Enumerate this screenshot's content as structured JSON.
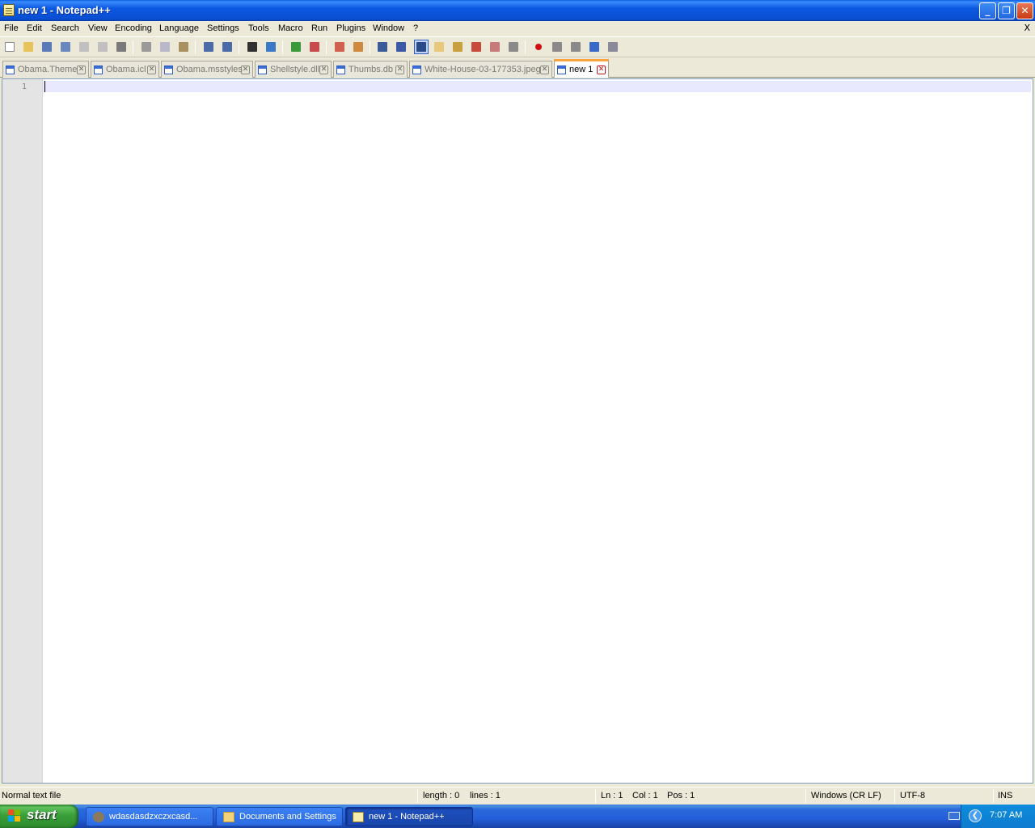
{
  "window": {
    "title": "new 1 - Notepad++",
    "min_glyph": "_",
    "max_glyph": "❐",
    "close_glyph": "✕"
  },
  "menu": {
    "items": [
      "File",
      "Edit",
      "Search",
      "View",
      "Encoding",
      "Language",
      "Settings",
      "Tools",
      "Macro",
      "Run",
      "Plugins",
      "Window",
      "?"
    ],
    "close": "X"
  },
  "toolbar": {
    "buttons": [
      {
        "name": "new-file-icon",
        "color": "#ffffff"
      },
      {
        "name": "open-file-icon",
        "color": "#e8c25a"
      },
      {
        "name": "save-icon",
        "color": "#5a7ab8"
      },
      {
        "name": "save-all-icon",
        "color": "#6a88c0"
      },
      {
        "name": "close-icon",
        "color": "#c0c0c0"
      },
      {
        "name": "close-all-icon",
        "color": "#c0c0c0"
      },
      {
        "name": "print-icon",
        "color": "#7a7a7a"
      },
      {
        "name": "cut-icon",
        "color": "#9a9a9a"
      },
      {
        "name": "copy-icon",
        "color": "#b8b8c8"
      },
      {
        "name": "paste-icon",
        "color": "#a89060"
      },
      {
        "name": "undo-icon",
        "color": "#4a6aa8"
      },
      {
        "name": "redo-icon",
        "color": "#4a6aa8"
      },
      {
        "name": "find-icon",
        "color": "#303030"
      },
      {
        "name": "replace-icon",
        "color": "#3a78c8"
      },
      {
        "name": "zoom-in-icon",
        "color": "#3a9a3a"
      },
      {
        "name": "zoom-out-icon",
        "color": "#c84a4a"
      },
      {
        "name": "sync-vertical-icon",
        "color": "#d06050"
      },
      {
        "name": "sync-horizontal-icon",
        "color": "#d08a40"
      },
      {
        "name": "word-wrap-icon",
        "color": "#3a5a9a"
      },
      {
        "name": "show-all-chars-icon",
        "color": "#3a5aa8"
      },
      {
        "name": "indent-guide-icon",
        "color": "#2a4a8a"
      },
      {
        "name": "user-language-icon",
        "color": "#e8c87a"
      },
      {
        "name": "doc-map-icon",
        "color": "#c8a040"
      },
      {
        "name": "function-list-icon",
        "color": "#c84a3a"
      },
      {
        "name": "folder-as-workspace-icon",
        "color": "#c87a7a"
      },
      {
        "name": "monitoring-icon",
        "color": "#8a8a8a"
      },
      {
        "name": "record-macro-icon",
        "color": "#d01010"
      },
      {
        "name": "stop-recording-icon",
        "color": "#8a8a8a"
      },
      {
        "name": "playback-macro-icon",
        "color": "#8a8a8a"
      },
      {
        "name": "run-macro-multiple-icon",
        "color": "#3a6ac8"
      },
      {
        "name": "save-macro-icon",
        "color": "#8a8a9a"
      }
    ]
  },
  "tabs": [
    {
      "label": "Obama.Theme",
      "active": false
    },
    {
      "label": "Obama.icl",
      "active": false
    },
    {
      "label": "Obama.msstyles",
      "active": false
    },
    {
      "label": "Shellstyle.dll",
      "active": false
    },
    {
      "label": "Thumbs.db",
      "active": false
    },
    {
      "label": "White-House-03-177353.jpeg",
      "active": false
    },
    {
      "label": "new 1",
      "active": true
    }
  ],
  "tab_close_glyph": "✕",
  "editor": {
    "line_number": "1",
    "content": ""
  },
  "status": {
    "file_type": "Normal text file",
    "length": "length : 0",
    "lines": "lines : 1",
    "ln": "Ln : 1",
    "col": "Col : 1",
    "pos": "Pos : 1",
    "eol": "Windows (CR LF)",
    "encoding": "UTF-8",
    "mode": "INS"
  },
  "taskbar": {
    "start_label": "start",
    "tasks": [
      {
        "label": "wdasdasdzxczxcasd...",
        "active": false,
        "icon": "app-icon"
      },
      {
        "label": "Documents and Settings",
        "active": false,
        "icon": "folder-icon"
      },
      {
        "label": "new 1 - Notepad++",
        "active": true,
        "icon": "notepad-icon"
      }
    ],
    "tray_chevron": "❮",
    "clock": "7:07 AM"
  }
}
